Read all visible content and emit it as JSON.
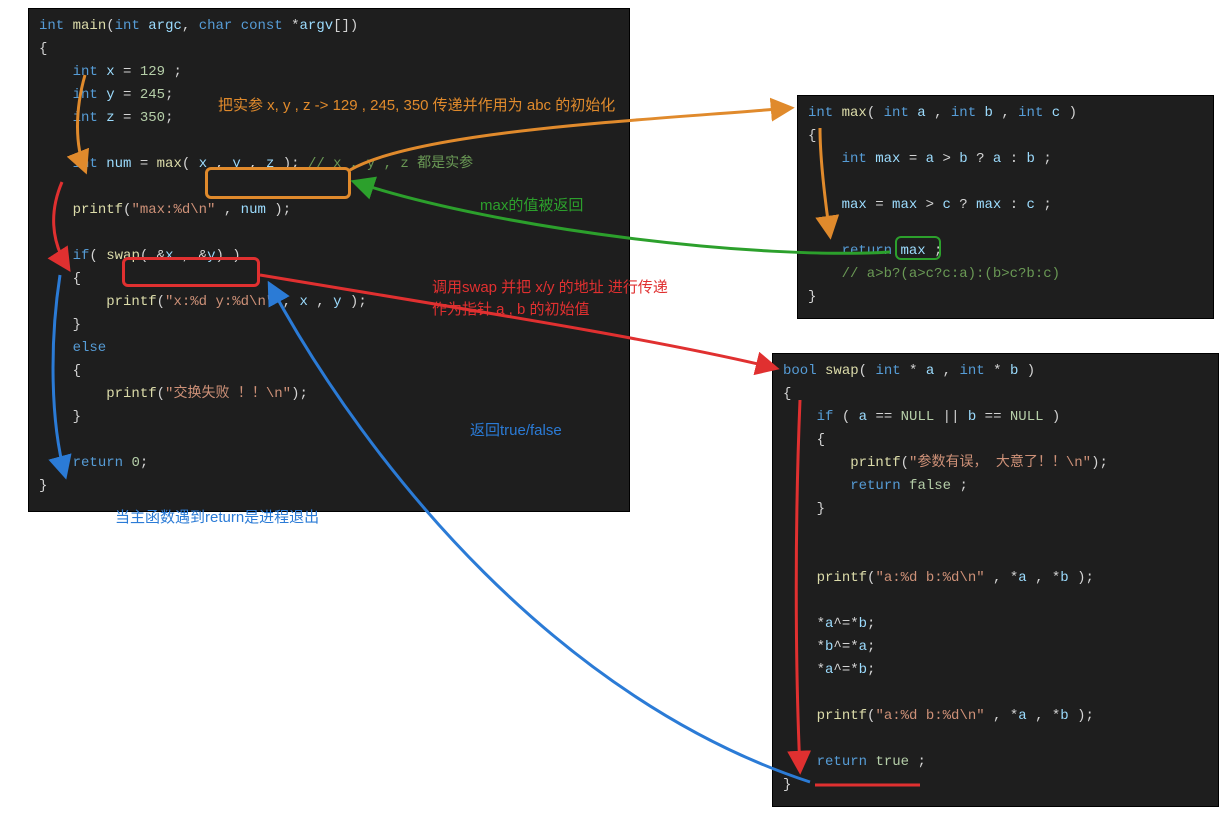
{
  "main_code": {
    "sig": "int main(int argc, char const *argv[])",
    "decls": [
      "    int x = 129 ;",
      "    int y = 245;",
      "    int z = 350;"
    ],
    "num_line_pre": "    int num = ",
    "num_call": "max( x , y , z )",
    "num_line_post": "; ",
    "num_cmt": "// x , y , z 都是实参",
    "printf1_a": "    printf(",
    "printf1_str": "\"max:%d\\n\"",
    "printf1_b": " , num );",
    "if_pre": "    if( ",
    "swap_call": "swap( &x , &y)",
    "if_post": " )",
    "printf2_a": "        printf(",
    "printf2_str": "\"x:%d y:%d\\n\"",
    "printf2_b": " , x , y );",
    "else_kw": "    else",
    "printf3_a": "        printf(",
    "printf3_str": "\"交换失败 ！！\\n\"",
    "printf3_b": ");",
    "ret": "    return 0;"
  },
  "max_code": {
    "sig": "int max( int a , int b , int c )",
    "l1": "    int max = a > b ? a : b ;",
    "l2": "    max = max > c ? max : c ;",
    "ret": "    return max ;",
    "cmt": "    // a>b?(a>c?c:a):(b>c?b:c)"
  },
  "swap_code": {
    "sig": "bool swap( int * a , int * b )",
    "if_line": "    if ( a == NULL || b == NULL )",
    "err_a": "        printf(",
    "err_str": "\"参数有误， 大意了！！\\n\"",
    "err_b": ");",
    "ret_false": "        return false ;",
    "p1_a": "    printf(",
    "p1_str": "\"a:%d b:%d\\n\"",
    "p1_b": " , *a , *b );",
    "xor1": "    *a^=*b;",
    "xor2": "    *b^=*a;",
    "xor3": "    *a^=*b;",
    "p2_a": "    printf(",
    "p2_str": "\"a:%d b:%d\\n\"",
    "p2_b": " , *a , *b );",
    "ret_true": "    return true ;"
  },
  "annotations": {
    "orange": "把实参  x, y , z  ->  129 , 245, 350  传递并作用为 abc 的初始化",
    "green": "max的值被返回",
    "red_l1": "调用swap 并把 x/y 的地址 进行传递",
    "red_l2": "作为指针 a , b 的初始值",
    "blue_a": "返回true/false",
    "blue_b": "当主函数遇到return是进程退出"
  }
}
